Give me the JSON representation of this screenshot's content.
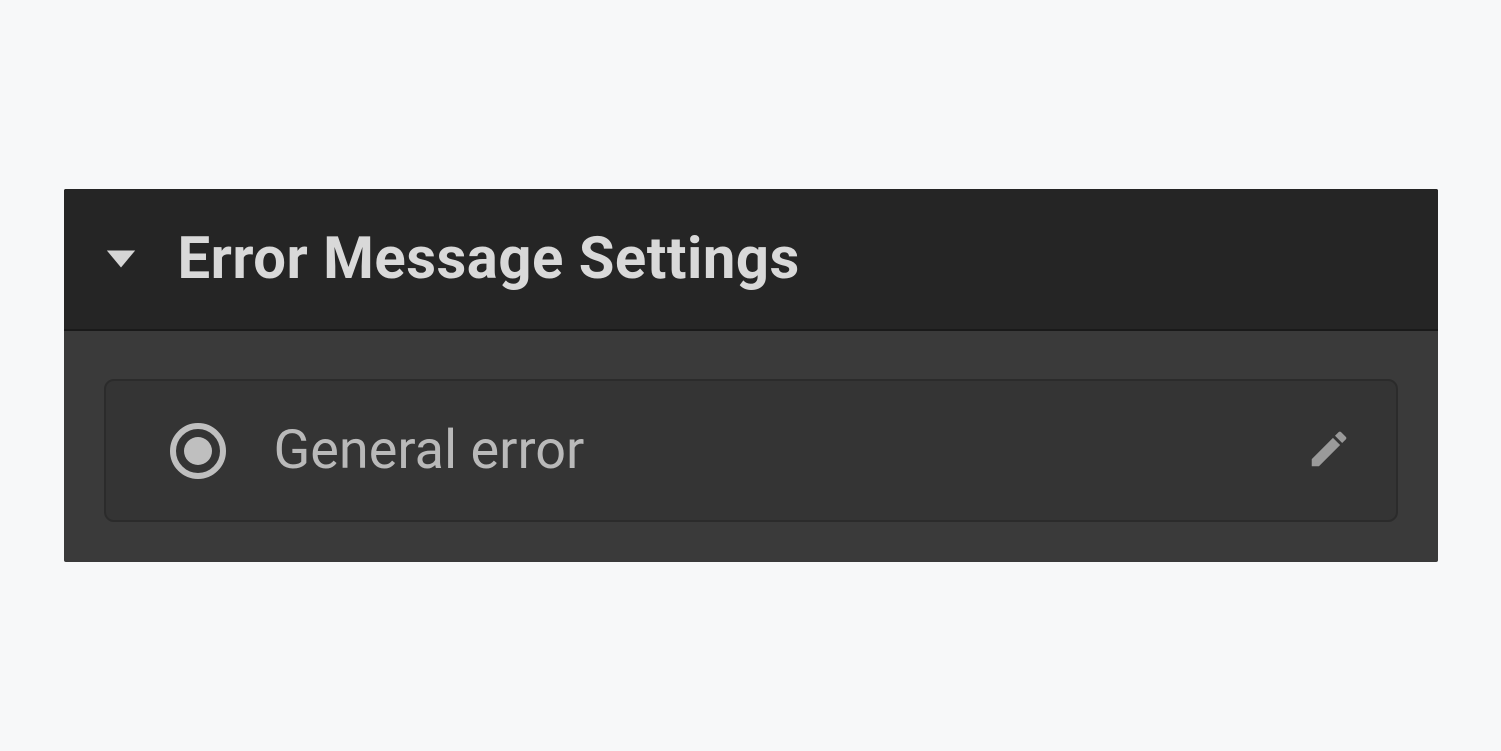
{
  "panel": {
    "title": "Error Message Settings",
    "expanded": true,
    "items": [
      {
        "label": "General error",
        "selected": true
      }
    ]
  }
}
